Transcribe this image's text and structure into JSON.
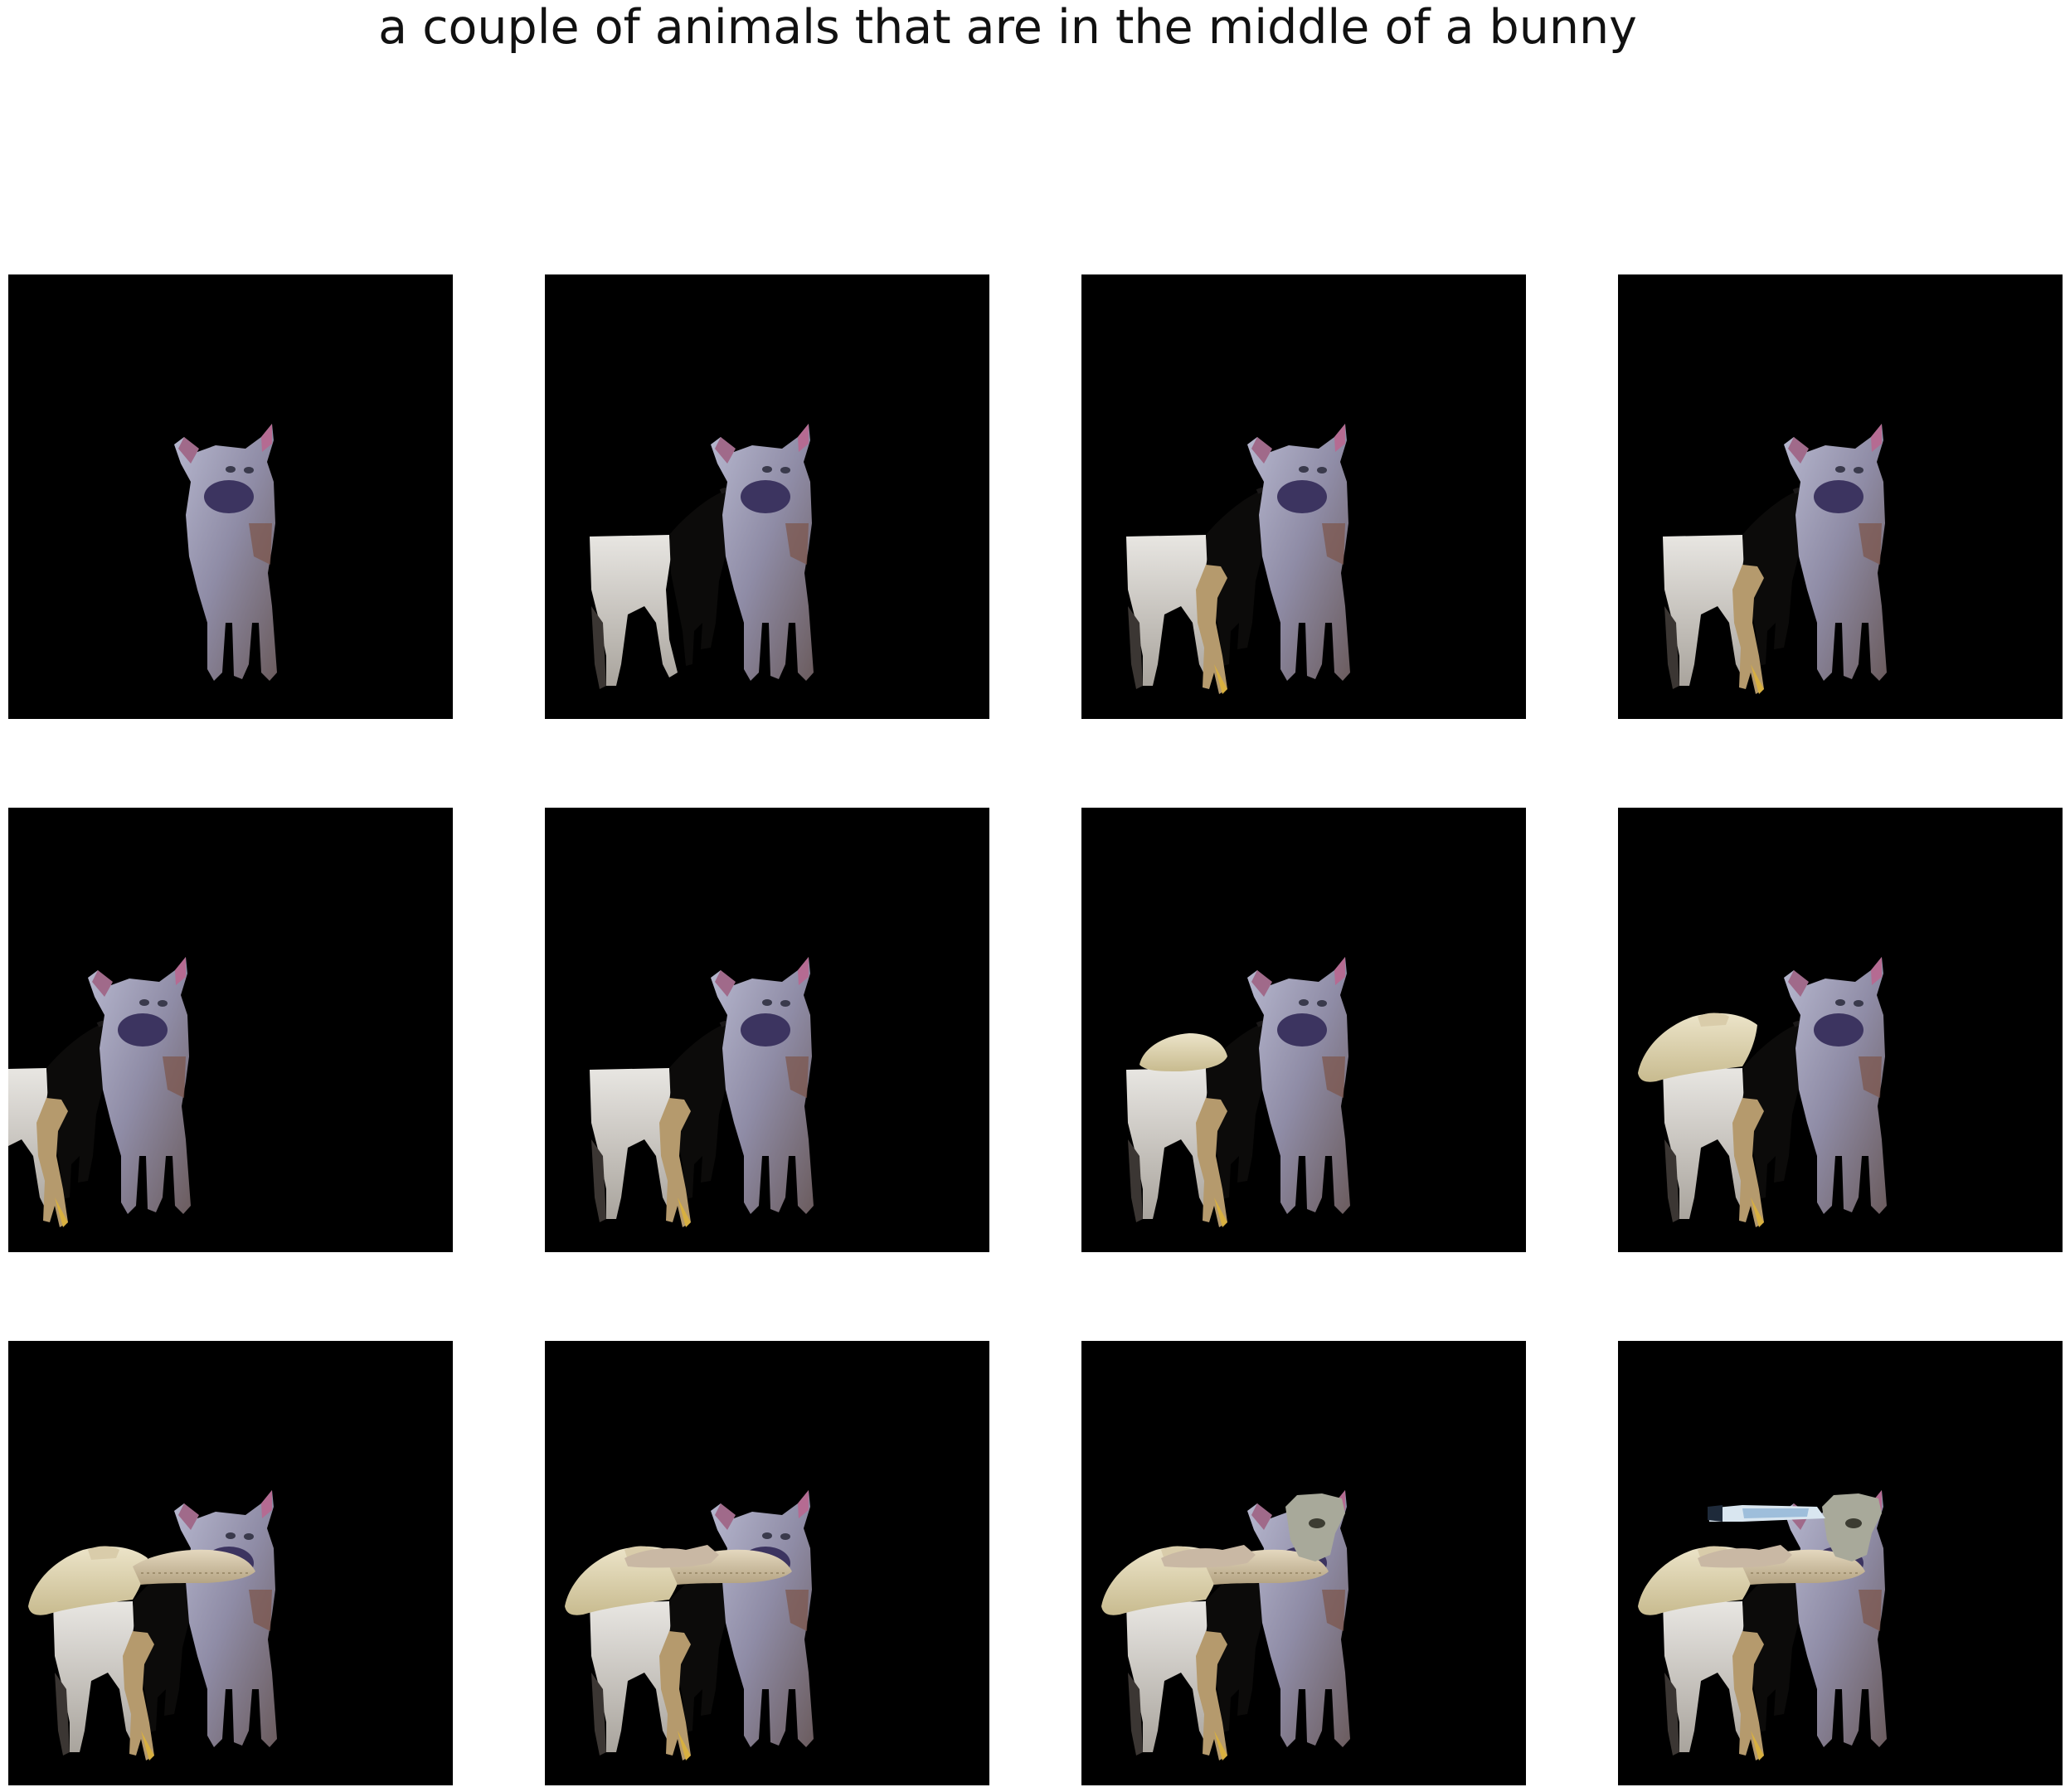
{
  "title": "a couple of animals that are in the middle of a bunny",
  "panels": [
    {
      "step": 1,
      "layers": [
        "lamb"
      ]
    },
    {
      "step": 2,
      "layers": [
        "white-sheep",
        "black-goat",
        "lamb"
      ]
    },
    {
      "step": 3,
      "layers": [
        "white-sheep",
        "black-goat",
        "tan-goat",
        "lamb"
      ]
    },
    {
      "step": 4,
      "layers": [
        "white-sheep",
        "black-goat",
        "tan-goat",
        "lamb"
      ]
    },
    {
      "step": 5,
      "layers": [
        "white-sheep",
        "black-goat",
        "tan-goat",
        "lamb"
      ]
    },
    {
      "step": 6,
      "layers": [
        "white-sheep",
        "black-goat",
        "tan-goat",
        "lamb"
      ]
    },
    {
      "step": 7,
      "layers": [
        "white-sheep",
        "black-goat",
        "tan-goat",
        "lamb",
        "small-fleece"
      ]
    },
    {
      "step": 8,
      "layers": [
        "white-sheep",
        "black-goat",
        "tan-goat",
        "lamb",
        "large-fleece"
      ]
    },
    {
      "step": 9,
      "layers": [
        "white-sheep",
        "black-goat",
        "tan-goat",
        "lamb",
        "large-fleece",
        "rough-fleece"
      ]
    },
    {
      "step": 10,
      "layers": [
        "white-sheep",
        "black-goat",
        "tan-goat",
        "lamb",
        "large-fleece",
        "rough-fleece",
        "lying-lamb"
      ]
    },
    {
      "step": 11,
      "layers": [
        "white-sheep",
        "black-goat",
        "tan-goat",
        "lamb",
        "large-fleece",
        "rough-fleece",
        "lying-lamb",
        "sheep-head"
      ]
    },
    {
      "step": 12,
      "layers": [
        "white-sheep",
        "black-goat",
        "tan-goat",
        "lamb",
        "large-fleece",
        "rough-fleece",
        "lying-lamb",
        "sheep-head",
        "blue-strip"
      ]
    }
  ]
}
